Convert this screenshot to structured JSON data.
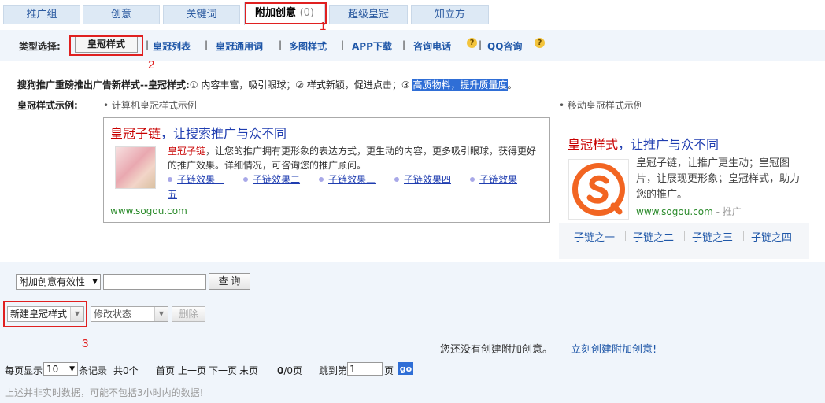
{
  "tabs": [
    {
      "label": "推广组"
    },
    {
      "label": "创意"
    },
    {
      "label": "关键词"
    },
    {
      "label": "附加创意",
      "count": "(0)"
    },
    {
      "label": "超级皇冠"
    },
    {
      "label": "知立方"
    }
  ],
  "annotations": {
    "n1": "1",
    "n2": "2",
    "n3": "3"
  },
  "type_bar": {
    "label": "类型选择:",
    "selected": "皇冠样式",
    "links": [
      "皇冠列表",
      "皇冠通用词",
      "多图样式",
      "APP下载",
      "咨询电话",
      "QQ咨询"
    ],
    "sep": "|",
    "help_glyph": "?"
  },
  "intro": {
    "lead": "搜狗推广重磅推出广告新样式--皇冠样式:",
    "points": "① 内容丰富，吸引眼球；② 样式新颖，促进点击；③ ",
    "highlight": "高质物料，提升质量度",
    "end": "。"
  },
  "examples": {
    "label": "皇冠样式示例:",
    "pc_title": "• 计算机皇冠样式示例",
    "mobile_title": "• 移动皇冠样式示例"
  },
  "pc_card": {
    "headline_red": "皇冠子链",
    "headline_rest": "，让搜索推广与众不同",
    "desc_red": "皇冠子链",
    "desc_rest": "，让您的推广拥有更形象的表达方式，更生动的内容，更多吸引眼球，获得更好的推广效果。详细情况，可咨询您的推广顾问。",
    "sublinks": [
      "子链效果一",
      "子链效果二",
      "子链效果三",
      "子链效果四",
      "子链效果"
    ],
    "sublink_wrap": "五",
    "url": "www.sogou.com"
  },
  "mobile_card": {
    "headline_red": "皇冠样式",
    "headline_rest": "，让推广与众不同",
    "desc": "皇冠子链，让推广更生动；皇冠图片，让展现更形象；皇冠样式，助力您的推广。",
    "url": "www.sogou.com",
    "url_suffix": " - 推广",
    "links": [
      "子链之一",
      "子链之二",
      "子链之三",
      "子链之四"
    ],
    "colors": {
      "logo_orange": "#f26522"
    }
  },
  "filter": {
    "select_value": "附加创意有效性",
    "search_value": "",
    "query_button": "查 询"
  },
  "actions": {
    "new_combo": "新建皇冠样式",
    "status_combo": "修改状态",
    "delete_button": "删除"
  },
  "empty": {
    "message": "您还没有创建附加创意。",
    "create_link": "立刻创建附加创意!"
  },
  "pager": {
    "per_page_label": "每页显示",
    "per_page_value": "10",
    "records_label": "条记录",
    "total": "共0个",
    "first": "首页",
    "prev": "上一页",
    "next": "下一页",
    "last": "末页",
    "page_info_bold": "0",
    "page_info_rest": "/0页",
    "jump_label": "跳到第",
    "jump_value": "1",
    "page_suffix": "页",
    "go": "go"
  },
  "note": "上述并非实时数据，可能不包括3小时内的数据!"
}
